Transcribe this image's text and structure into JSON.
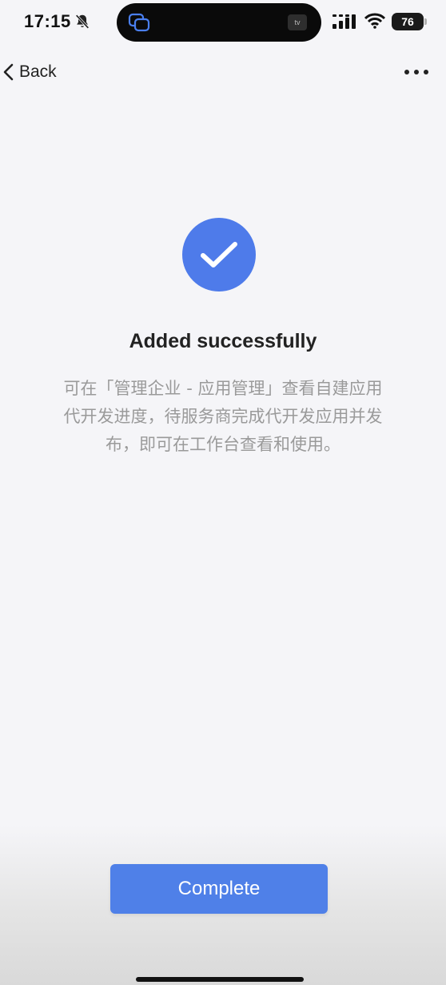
{
  "status_bar": {
    "time": "17:15",
    "battery_level": "76",
    "island_right_label": "tv"
  },
  "nav": {
    "back_label": "Back"
  },
  "result": {
    "title": "Added successfully",
    "description": "可在「管理企业 - 应用管理」查看自建应用代开发进度，待服务商完成代开发应用并发布，即可在工作台查看和使用。"
  },
  "actions": {
    "complete_label": "Complete"
  },
  "colors": {
    "accent": "#4f80e8",
    "success_circle": "#4e7bea",
    "background": "#f5f5f8",
    "description_text": "#9a9a9a"
  },
  "icons": {
    "status": [
      "bell-off-icon",
      "island-app-icon",
      "cellular-signal-icon",
      "wifi-icon",
      "battery-icon"
    ],
    "nav": [
      "chevron-left-icon",
      "more-icon"
    ],
    "result": "checkmark-icon"
  }
}
